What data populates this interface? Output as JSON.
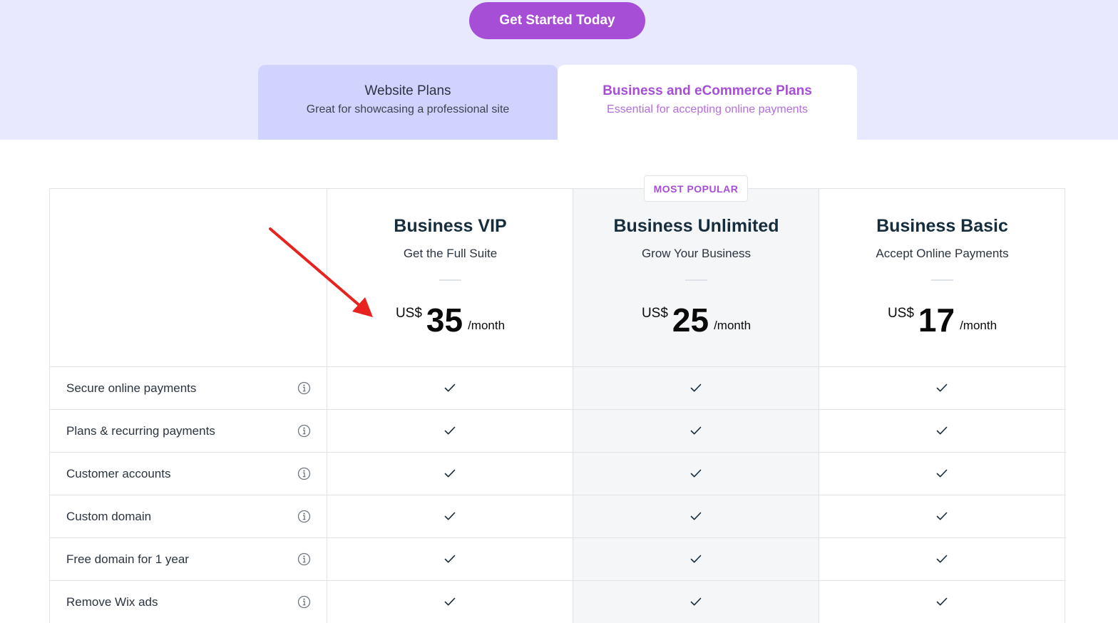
{
  "cta": {
    "label": "Get Started Today"
  },
  "tabs": [
    {
      "title": "Website Plans",
      "subtitle": "Great for showcasing a professional site",
      "active": false
    },
    {
      "title": "Business and eCommerce Plans",
      "subtitle": "Essential for accepting online payments",
      "active": true
    }
  ],
  "badge": "MOST POPULAR",
  "plans": [
    {
      "name": "Business VIP",
      "tagline": "Get the Full Suite",
      "currency": "US$",
      "price": "35",
      "period": "/month"
    },
    {
      "name": "Business Unlimited",
      "tagline": "Grow Your Business",
      "currency": "US$",
      "price": "25",
      "period": "/month"
    },
    {
      "name": "Business Basic",
      "tagline": "Accept Online Payments",
      "currency": "US$",
      "price": "17",
      "period": "/month"
    }
  ],
  "features": [
    {
      "label": "Secure online payments",
      "included": [
        true,
        true,
        true
      ]
    },
    {
      "label": "Plans & recurring payments",
      "included": [
        true,
        true,
        true
      ]
    },
    {
      "label": "Customer accounts",
      "included": [
        true,
        true,
        true
      ]
    },
    {
      "label": "Custom domain",
      "included": [
        true,
        true,
        true
      ]
    },
    {
      "label": "Free domain for 1 year",
      "included": [
        true,
        true,
        true
      ]
    },
    {
      "label": "Remove Wix ads",
      "included": [
        true,
        true,
        true
      ]
    }
  ],
  "colors": {
    "accent": "#a64fd6",
    "hero_bg": "#e8e8fe",
    "inactive_tab": "#cfd3fd",
    "arrow": "#e8231f"
  },
  "icons": {
    "info": "info-circle-icon",
    "check": "checkmark-icon",
    "annotation": "red-arrow-annotation"
  }
}
